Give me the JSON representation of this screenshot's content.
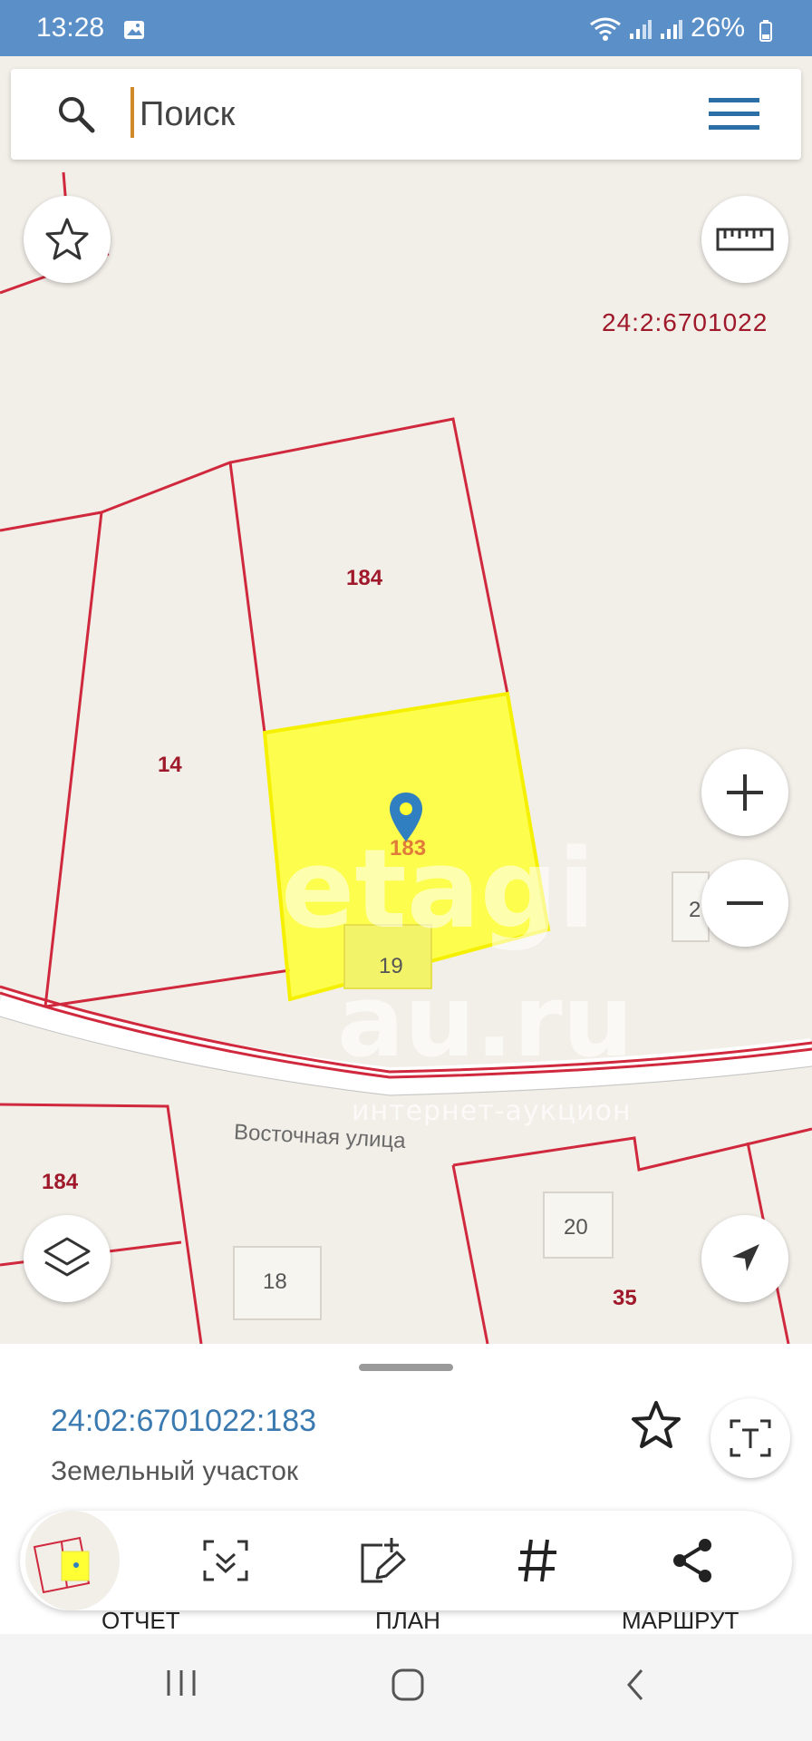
{
  "status_bar": {
    "time": "13:28",
    "battery": "26%"
  },
  "search": {
    "placeholder": "Поиск"
  },
  "map": {
    "cadastral_block": "24:2:6701022",
    "parcels": {
      "p184_top": "184",
      "p14": "14",
      "p183": "183",
      "p184_bottom": "184",
      "p35": "35"
    },
    "house_numbers": {
      "h19": "19",
      "h2": "2",
      "h18": "18",
      "h20": "20"
    },
    "street": "Восточная улица",
    "watermark": {
      "line1": "etagi",
      "line2": "au.ru",
      "line3": "интернет-аукцион"
    }
  },
  "selected_object": {
    "cadastral_number": "24:02:6701022:183",
    "type": "Земельный участок"
  },
  "bottom_labels": {
    "report": "ОТЧЕТ",
    "plan": "ПЛАН",
    "route": "МАРШРУТ"
  },
  "colors": {
    "status_bar": "#5b8fc8",
    "parcel_border": "#d0283c",
    "highlight": "#ffff33",
    "pin": "#2f7fc1",
    "link_text": "#3a7ab0"
  }
}
